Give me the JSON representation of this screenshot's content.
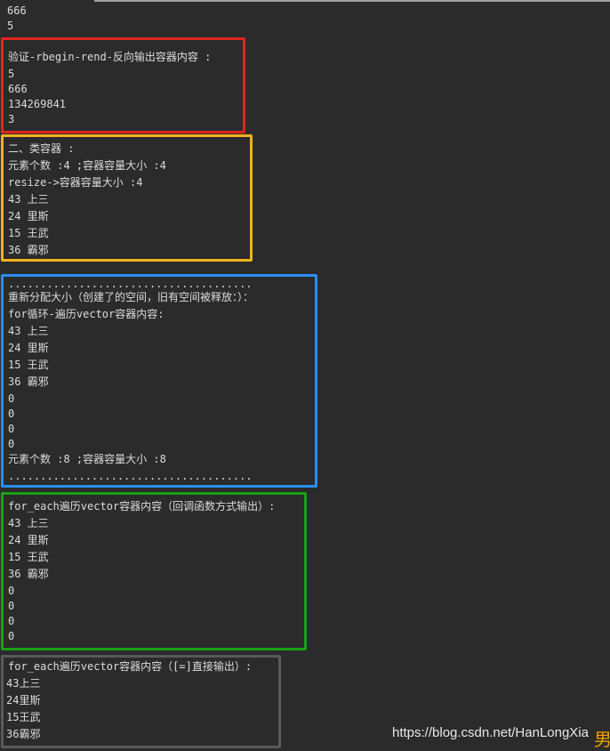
{
  "console": {
    "top_lines": [
      "666",
      "5"
    ],
    "section_reverse": {
      "lines": [
        "验证-rbegin-rend-反向输出容器内容 :",
        "5",
        "666",
        "134269841",
        "3"
      ]
    },
    "section_class": {
      "lines": [
        "二、类容器 :",
        "元素个数 :4 ;容器容量大小 :4",
        "resize->容器容量大小 :4",
        "43 上三",
        "24 里斯",
        "15 王武",
        "36 霸邪"
      ]
    },
    "section_realloc": {
      "lines": [
        "......................................",
        "重新分配大小（创建了的空间，旧有空间被释放：）：",
        "for循环-遍历vector容器内容:",
        "43 上三",
        "24 里斯",
        "15 王武",
        "36 霸邪",
        "0",
        "0",
        "0",
        "0",
        "元素个数 :8 ;容器容量大小 :8",
        "......................................"
      ]
    },
    "section_for_each": {
      "lines": [
        "for_each遍历vector容器内容（回调函数方式输出）:",
        "43 上三",
        "24 里斯",
        "15 王武",
        "36 霸邪",
        "0",
        "0",
        "0",
        "0"
      ]
    },
    "section_lambda": {
      "lines": [
        "for_each遍历vector容器内容（[=]直接输出）:",
        "43上三",
        "24里斯",
        "15王武",
        "36霸邪"
      ]
    }
  },
  "watermark": "https://blog.csdn.net/HanLongXia",
  "corner_glyph": "男",
  "colors": {
    "background": "#2b2b2b",
    "text": "#dcdcdc",
    "box_red": "#e0241f",
    "box_yellow": "#f4b120",
    "box_blue": "#2a8ef0",
    "box_green": "#18a116",
    "box_gray": "#5a5a5a"
  }
}
